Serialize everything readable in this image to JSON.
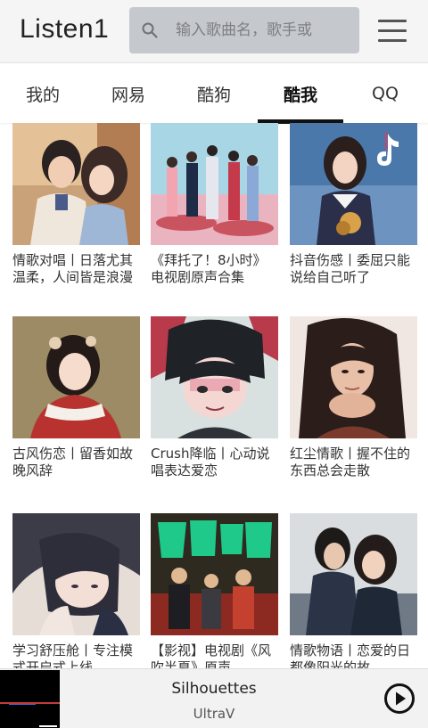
{
  "header": {
    "app_title": "Listen1",
    "search_placeholder": "输入歌曲名，歌手或"
  },
  "tabs": [
    {
      "label": "我的"
    },
    {
      "label": "网易"
    },
    {
      "label": "酷狗"
    },
    {
      "label": "酷我",
      "active": true
    },
    {
      "label": "QQ"
    }
  ],
  "playlists": [
    {
      "title": "情歌对唱丨日落尤其温柔，人间皆是浪漫",
      "cover_icon": "couple-cover"
    },
    {
      "title": "《拜托了！8小时》电视剧原声合集",
      "cover_icon": "drama-cast-cover"
    },
    {
      "title": "抖音伤感丨委屈只能说给自己听了",
      "cover_icon": "tiktok-girl-cover"
    },
    {
      "title": "古风伤恋丨留香如故晚风辞",
      "cover_icon": "ancient-style-girl-cover"
    },
    {
      "title": "Crush降临丨心动说唱表达爱恋",
      "cover_icon": "anime-boy-cover"
    },
    {
      "title": "红尘情歌丨握不住的东西总会走散",
      "cover_icon": "woman-portrait-cover"
    },
    {
      "title": "学习舒压舱丨专注模式开启式上线",
      "cover_icon": "anime-girl-cover"
    },
    {
      "title": "【影视】电视剧《风吹半夏》原声",
      "cover_icon": "tv-poster-cover"
    },
    {
      "title": "情歌物语丨恋爱的日都像阳光的故",
      "cover_icon": "couple-photo-cover"
    }
  ],
  "player": {
    "song_title": "Silhouettes",
    "artist": "UltraV"
  }
}
